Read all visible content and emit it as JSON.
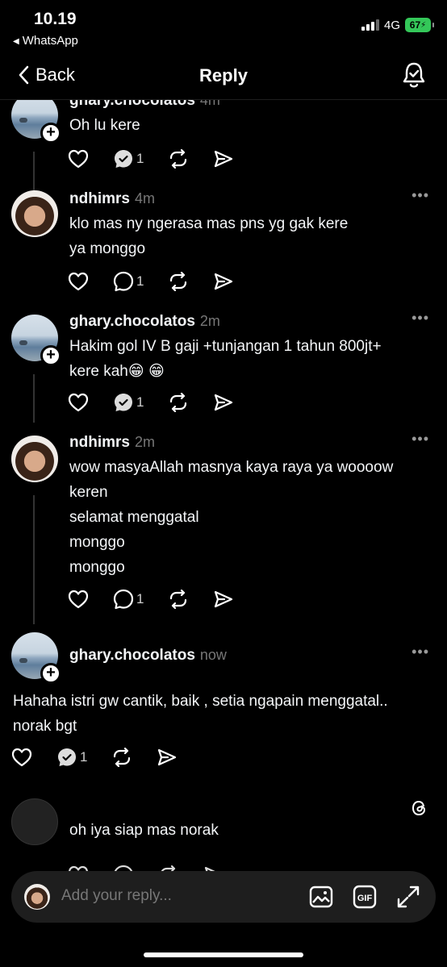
{
  "status_bar": {
    "time": "10.19",
    "back_app": "WhatsApp",
    "network": "4G",
    "battery": "67"
  },
  "nav": {
    "back_label": "Back",
    "title": "Reply"
  },
  "posts": [
    {
      "username": "ghary.chocolatos",
      "time": "4m",
      "lines": [
        "Oh lu kere"
      ],
      "reply_count": "1"
    },
    {
      "username": "ndhimrs",
      "time": "4m",
      "lines": [
        "klo mas ny ngerasa mas pns yg gak kere",
        "ya monggo"
      ],
      "reply_count": "1"
    },
    {
      "username": "ghary.chocolatos",
      "time": "2m",
      "lines": [
        "Hakim gol IV B gaji +tunjangan 1 tahun 800jt+",
        "kere kah😁 😁"
      ],
      "reply_count": "1"
    },
    {
      "username": "ndhimrs",
      "time": "2m",
      "lines": [
        "wow masyaAllah masnya kaya raya ya woooow",
        "keren",
        "selamat menggatal",
        "monggo",
        "monggo"
      ],
      "reply_count": "1"
    },
    {
      "username": "ghary.chocolatos",
      "time": "now",
      "lines": [
        "Hahaha istri gw cantik, baik , setia ngapain menggatal..",
        "norak bgt"
      ],
      "reply_count": "1"
    }
  ],
  "draft": {
    "text": "oh iya siap mas norak"
  },
  "composer": {
    "placeholder": "Add your reply..."
  }
}
